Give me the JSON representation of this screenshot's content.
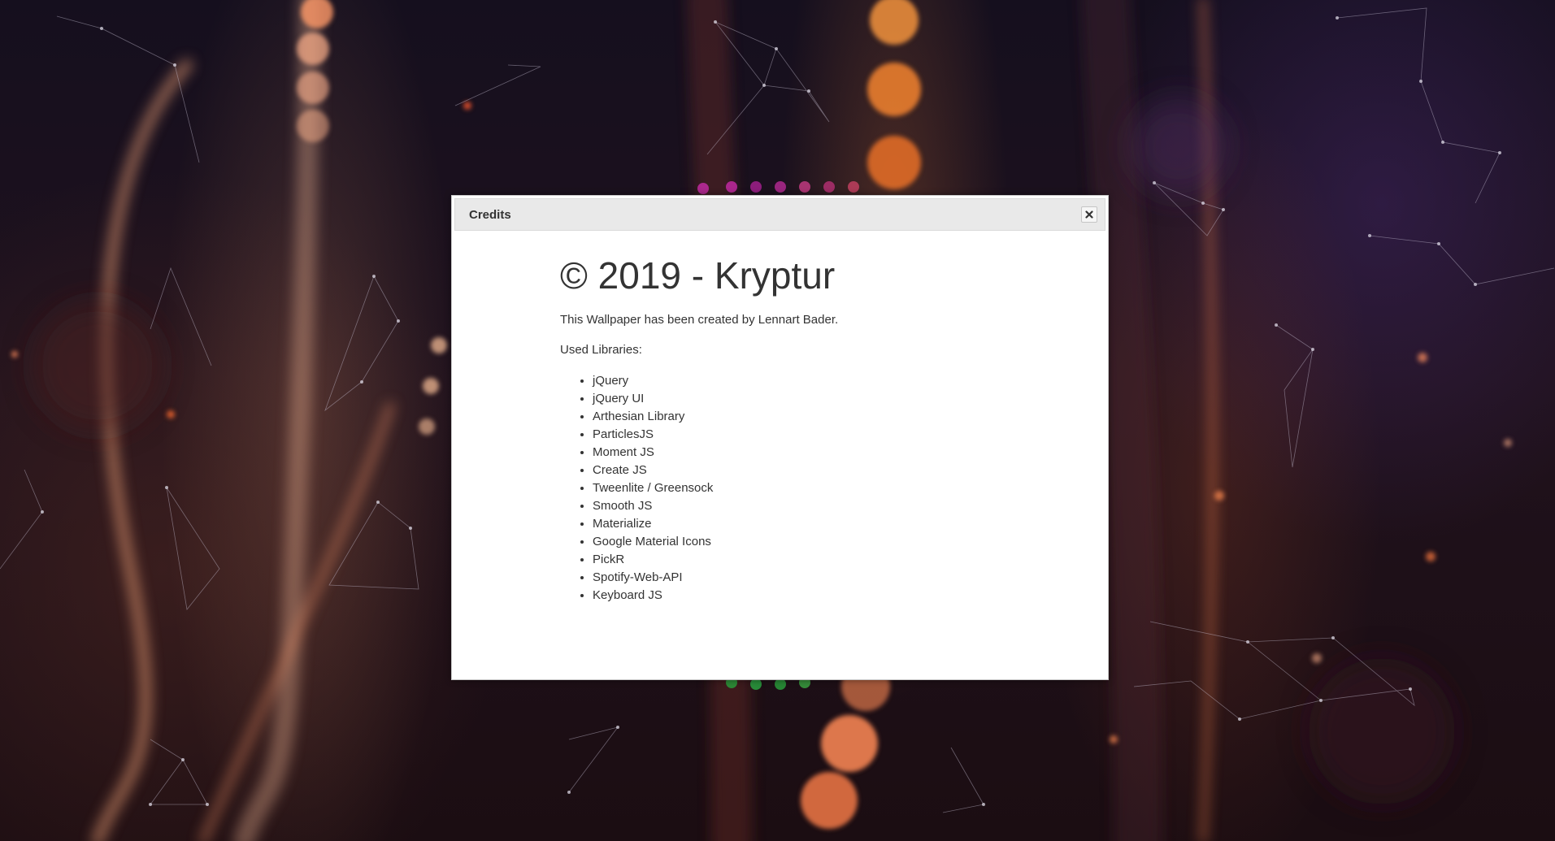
{
  "dialog": {
    "title": "Credits",
    "close_icon": "close-icon",
    "heading": "© 2019 - Kryptur",
    "description": "This Wallpaper has been created by Lennart Bader.",
    "libraries_label": "Used Libraries:",
    "libraries": [
      "jQuery",
      "jQuery UI",
      "Arthesian Library",
      "ParticlesJS",
      "Moment JS",
      "Create JS",
      "Tweenlite / Greensock",
      "Smooth JS",
      "Materialize",
      "Google Material Icons",
      "PickR",
      "Spotify-Web-API",
      "Keyboard JS"
    ]
  },
  "colors": {
    "titlebar_bg": "#e9e9e9",
    "text": "#333333",
    "bokeh_orange": "#ff8a50",
    "background_dark": "#1b1020"
  }
}
